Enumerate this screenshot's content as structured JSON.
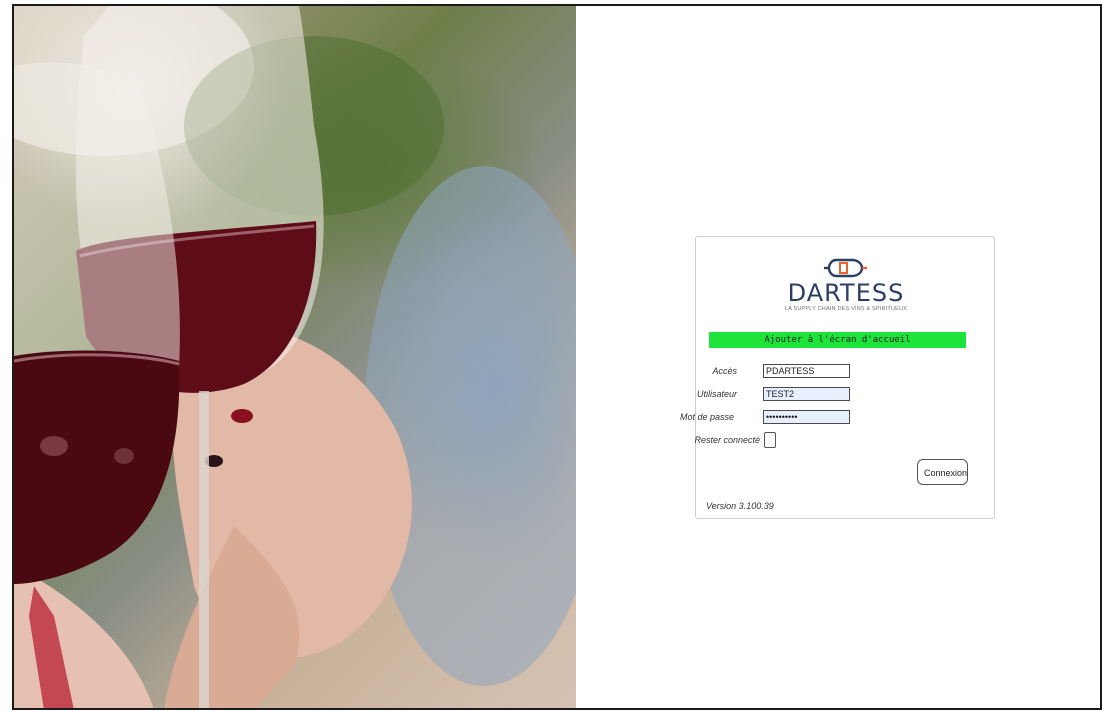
{
  "brand": {
    "name": "DARTESS",
    "tagline": "LA SUPPLY CHAIN DES VINS & SPIRITUEUX",
    "color": "#2c3e63",
    "accent": "#e8632b"
  },
  "banner": {
    "text": "Ajouter à l'écran d'accueil",
    "color": "#1ee33b"
  },
  "form": {
    "acces": {
      "label": "Accès",
      "value": "PDARTESS"
    },
    "utilisateur": {
      "label": "Utilisateur",
      "value": "TEST2"
    },
    "mot_de_passe": {
      "label": "Mot de passe",
      "value": "••••••••••"
    },
    "rester_connecte": {
      "label": "Rester connecté",
      "checked": false
    },
    "submit_label": "Connexion"
  },
  "version": "Version 3.100.39",
  "background": {
    "icon": "wine-glasses-photo"
  }
}
